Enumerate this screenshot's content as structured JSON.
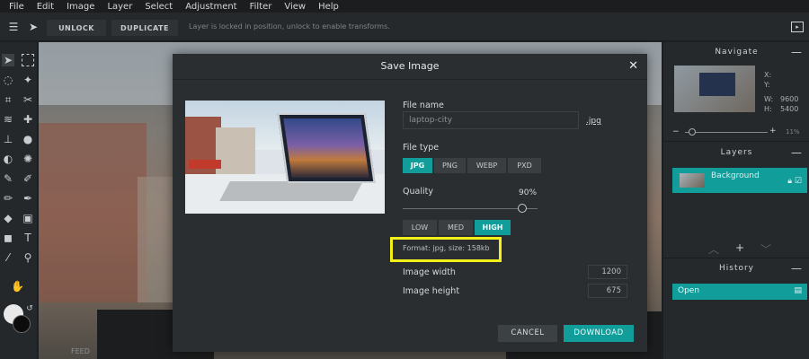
{
  "menu": [
    "File",
    "Edit",
    "Image",
    "Layer",
    "Select",
    "Adjustment",
    "Filter",
    "View",
    "Help"
  ],
  "toolbar": {
    "unlock_label": "UNLOCK",
    "duplicate_label": "DUPLICATE",
    "message": "Layer is locked in position, unlock to enable transforms."
  },
  "canvas": {
    "partial_label": "FEED"
  },
  "navigate": {
    "title": "Navigate",
    "x_label": "X:",
    "y_label": "Y:",
    "w_label": "W:",
    "w_value": "9600",
    "h_label": "H:",
    "h_value": "5400",
    "zoom": "11%",
    "zoom_level": 0.11
  },
  "layers": {
    "title": "Layers",
    "items": [
      {
        "name": "Background"
      }
    ]
  },
  "history": {
    "title": "History",
    "items": [
      {
        "label": "Open"
      }
    ]
  },
  "dialog": {
    "title": "Save Image",
    "file_name_label": "File name",
    "file_name_value": "laptop-city",
    "extension": ".jpg",
    "file_type_label": "File type",
    "file_types": [
      "JPG",
      "PNG",
      "WEBP",
      "PXD"
    ],
    "selected_file_type": "JPG",
    "quality_label": "Quality",
    "quality_value": "90%",
    "quality_level": 0.9,
    "quality_presets": [
      "LOW",
      "MED",
      "HIGH"
    ],
    "selected_quality_preset": "HIGH",
    "format_info": "Format: jpg, size: 158kb",
    "width_label": "Image width",
    "width_value": "1200",
    "height_label": "Image height",
    "height_value": "675",
    "cancel_label": "CANCEL",
    "download_label": "DOWNLOAD"
  },
  "colors": {
    "accent": "#119d9a",
    "highlight_box": "#f4f01a",
    "background": "#1f2224",
    "panel": "#26292b",
    "dialog": "#2b2e30"
  }
}
